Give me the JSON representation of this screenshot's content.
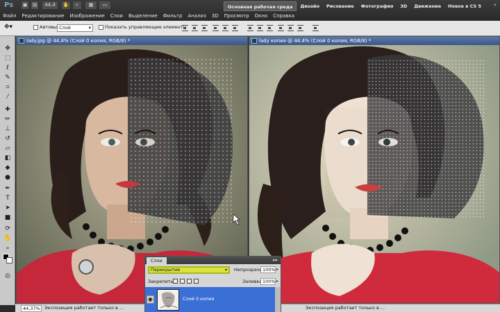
{
  "app": {
    "logo": "Ps",
    "zoom": "44,4",
    "menu": [
      "Файл",
      "Редактирование",
      "Изображение",
      "Слои",
      "Выделение",
      "Фильтр",
      "Анализ",
      "3D",
      "Просмотр",
      "Окно",
      "Справка"
    ],
    "workspaces": [
      "Основная рабочая среда",
      "Дизайн",
      "Рисование",
      "Фотография",
      "3D",
      "Движение",
      "Новое в CS 5"
    ],
    "active_workspace_index": 0
  },
  "options": {
    "autoselect_label": "Автовыбор:",
    "autoselect_value": "Слой",
    "show_controls_label": "Показать управляющие элементы"
  },
  "documents": [
    {
      "title": "lady.jpg @ 44,4% (Слой 0 копия, RGB/8) *"
    },
    {
      "title": "lady копия @ 44,4% (Слой 0 копия, RGB/8) *"
    }
  ],
  "status": {
    "zoom": "44,37%",
    "text": "Экспозиция работает только в ...",
    "text_right": "Экспозиция работает только в ..."
  },
  "layers": {
    "tab": "Слои",
    "blend_mode": "Перекрытие",
    "opacity_label": "Непрозрачность:",
    "opacity_value": "100%",
    "lock_label": "Закрепить:",
    "fill_label": "Заливка:",
    "fill_value": "100%",
    "layer_name": "Слой 0 копия",
    "highlight_color": "#d8e43a",
    "selected_row_color": "#3a6fd6"
  }
}
